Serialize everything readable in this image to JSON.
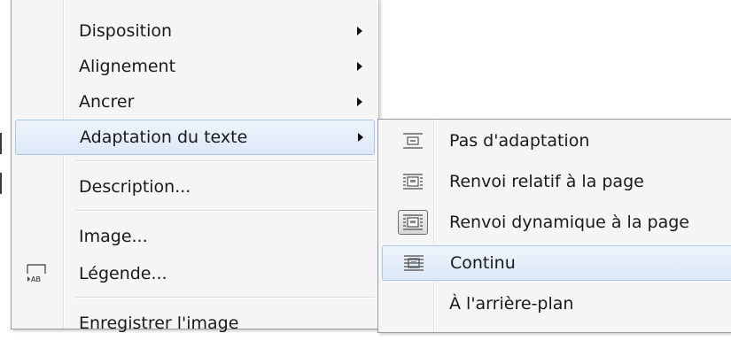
{
  "main_menu": {
    "items": [
      {
        "label": "Disposition",
        "has_submenu": true
      },
      {
        "label": "Alignement",
        "has_submenu": true
      },
      {
        "label": "Ancrer",
        "has_submenu": true
      },
      {
        "label": "Adaptation du texte",
        "has_submenu": true,
        "highlighted": true
      },
      {
        "label": "Description..."
      },
      {
        "label": "Image..."
      },
      {
        "label": "Légende...",
        "icon": "caption-icon",
        "icon_text": "AB"
      },
      {
        "label": "Enregistrer l'image"
      }
    ]
  },
  "submenu": {
    "items": [
      {
        "label": "Pas d'adaptation",
        "icon": "wrap-none-icon"
      },
      {
        "label": "Renvoi relatif à la page",
        "icon": "wrap-page-icon"
      },
      {
        "label": "Renvoi dynamique à la page",
        "icon": "wrap-dynamic-icon",
        "checked": true
      },
      {
        "label": "Continu",
        "icon": "wrap-through-icon",
        "highlighted": true
      },
      {
        "label": "À l'arrière-plan"
      }
    ]
  },
  "colors": {
    "menu_bg": "#f5f5f5",
    "highlight_border": "#a9c6ea",
    "highlight_fill": "#dce8f8"
  }
}
